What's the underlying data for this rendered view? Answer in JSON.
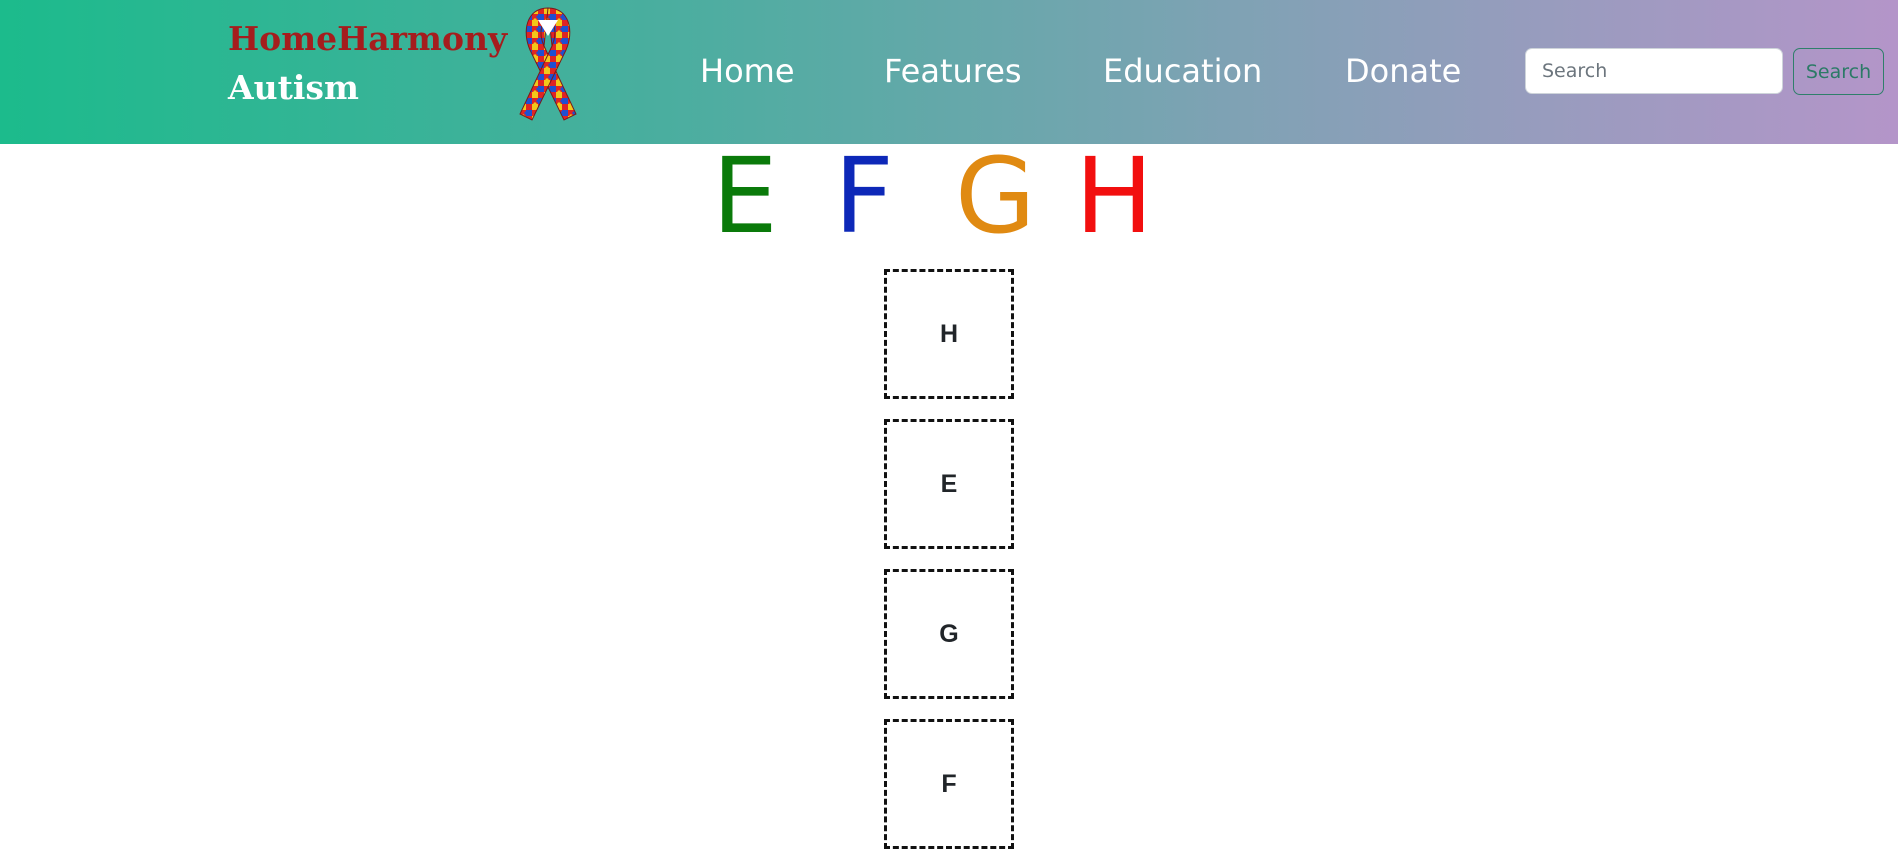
{
  "navbar": {
    "brand_line1": "HomeHarmony",
    "brand_line2": "Autism",
    "logo_icon": "autism-puzzle-ribbon-icon",
    "links": [
      "Home",
      "Features",
      "Education",
      "Donate"
    ],
    "search": {
      "placeholder": "Search",
      "value": "",
      "button_label": "Search"
    },
    "colors": {
      "gradient_start": "#1cbb8c",
      "gradient_end": "#b495c9",
      "brand_line1": "#a51d1d"
    }
  },
  "letters": [
    {
      "char": "E",
      "color": "#0a7a0a"
    },
    {
      "char": "F",
      "color": "#0d28b8"
    },
    {
      "char": "G",
      "color": "#e08a12"
    },
    {
      "char": "H",
      "color": "#f20f0f"
    }
  ],
  "drop_boxes": [
    "H",
    "E",
    "G",
    "F"
  ]
}
